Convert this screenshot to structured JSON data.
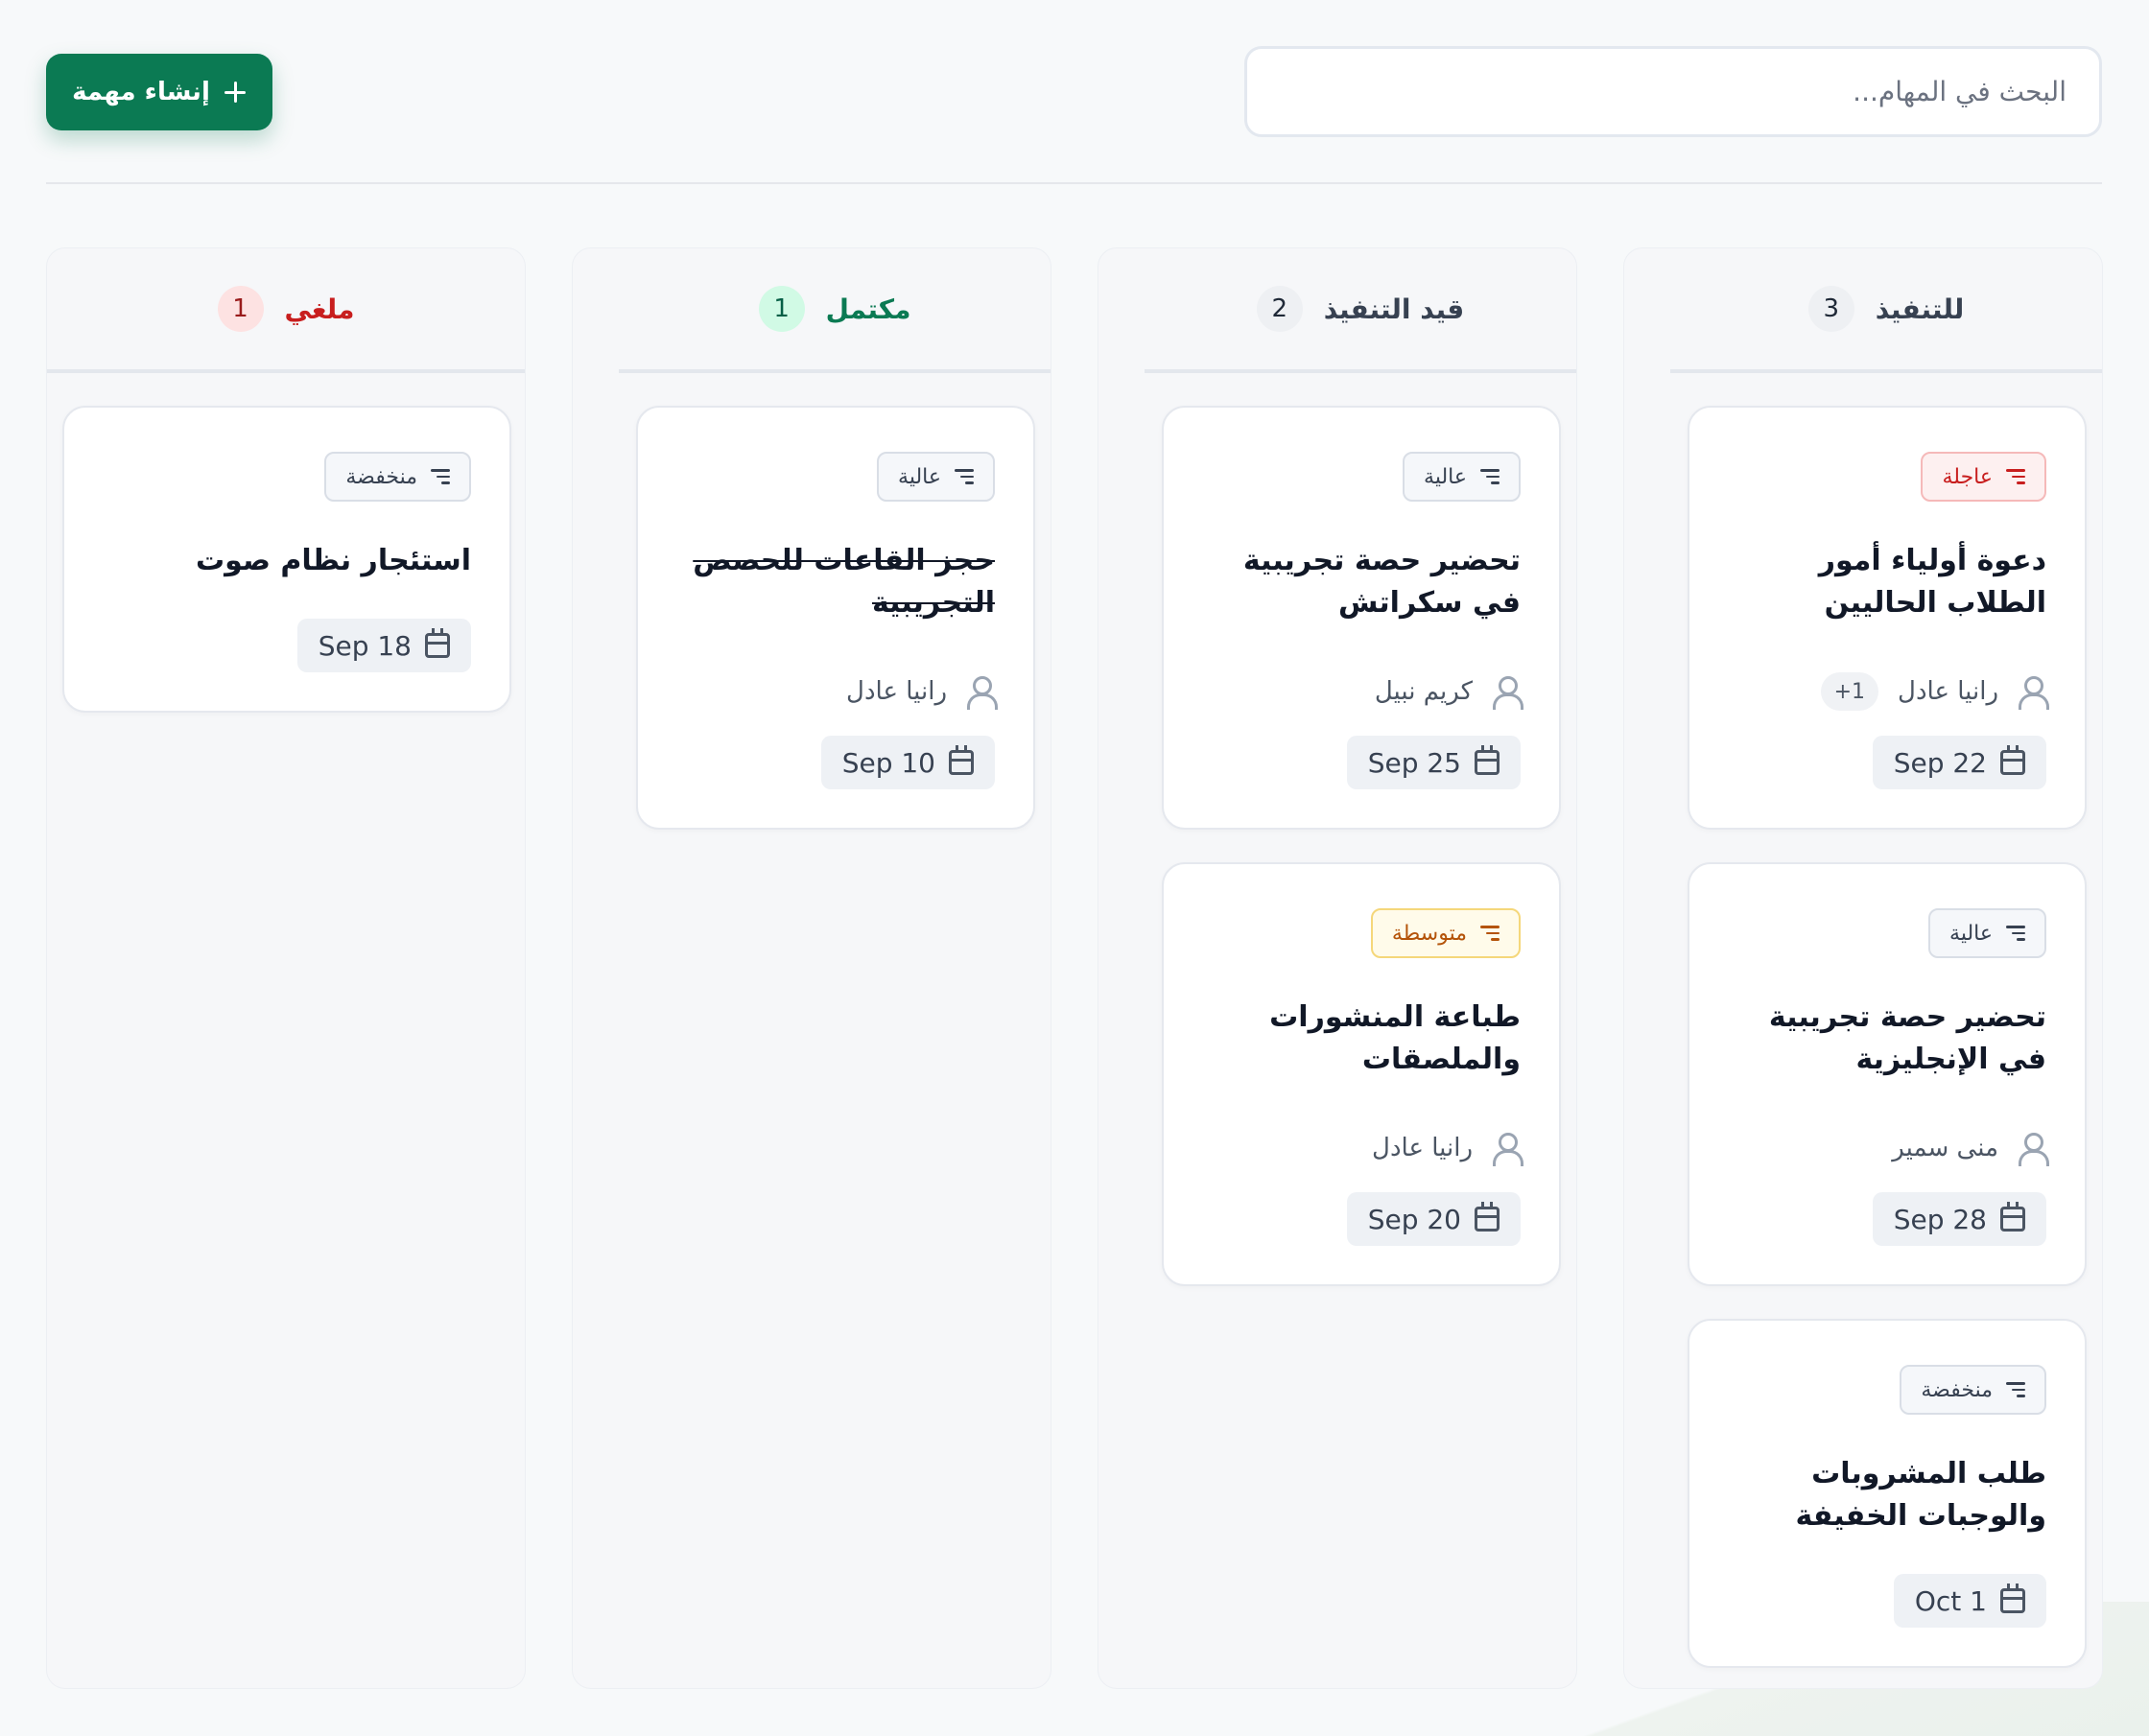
{
  "toolbar": {
    "create_label": "إنشاء مهمة",
    "search_placeholder": "البحث في المهام..."
  },
  "columns": [
    {
      "title": "للتنفيذ",
      "count": "3",
      "cards": [
        {
          "priority": "عاجلة",
          "title": "دعوة أولياء أمور الطلاب الحاليين",
          "assignee": "رانيا عادل",
          "extra": "+1",
          "date": "Sep 22"
        },
        {
          "priority": "عالية",
          "title": "تحضير حصة تجريبية في الإنجليزية",
          "assignee": "منى سمير",
          "date": "Sep 28"
        },
        {
          "priority": "منخفضة",
          "title": "طلب المشروبات والوجبات الخفيفة",
          "date": "Oct 1"
        }
      ]
    },
    {
      "title": "قيد التنفيذ",
      "count": "2",
      "cards": [
        {
          "priority": "عالية",
          "title": "تحضير حصة تجريبية في سكراتش",
          "assignee": "كريم نبيل",
          "date": "Sep 25"
        },
        {
          "priority": "متوسطة",
          "title": "طباعة المنشورات والملصقات",
          "assignee": "رانيا عادل",
          "date": "Sep 20"
        }
      ]
    },
    {
      "title": "مكتمل",
      "count": "1",
      "cards": [
        {
          "priority": "عالية",
          "title": "حجز القاعات للحصص التجريبية",
          "assignee": "رانيا عادل",
          "date": "Sep 10"
        }
      ]
    },
    {
      "title": "ملغي",
      "count": "1",
      "cards": [
        {
          "priority": "منخفضة",
          "title": "استئجار نظام صوت",
          "date": "Sep 18"
        }
      ]
    }
  ],
  "colors": {
    "brand_green": "#0b7a53",
    "todo_title": "#374151",
    "done_title": "#0b7a53",
    "done_count_bg": "#d1fae5",
    "cancelled_title": "#c81e1e",
    "cancelled_count_bg": "#fde2e2",
    "urgent": "#c81e1e",
    "medium": "#b45309"
  },
  "icons": {
    "create": "plus-icon",
    "priority": "lines-icon",
    "assignee": "user-icon",
    "date": "calendar-icon"
  }
}
